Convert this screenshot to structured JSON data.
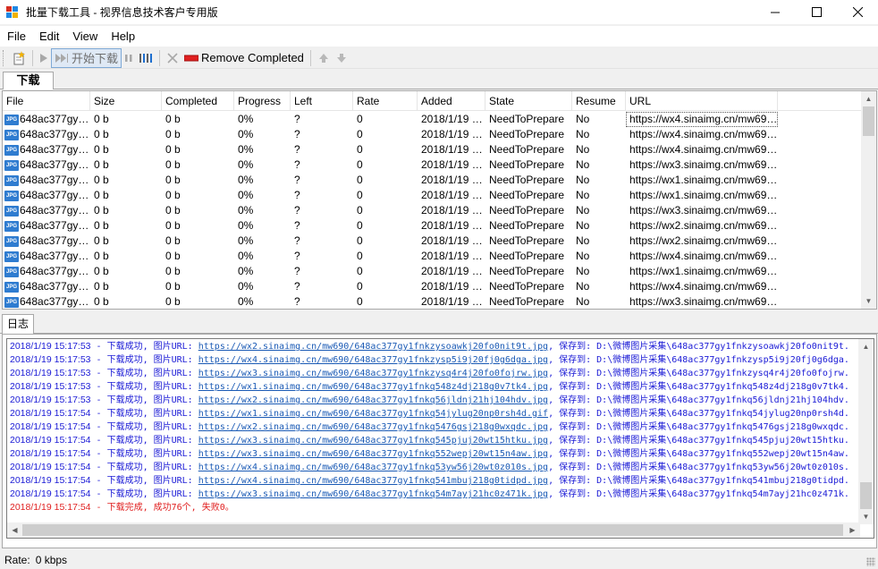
{
  "window": {
    "title": "批量下载工具 - 视界信息技术客户专用版",
    "minimize": "—",
    "maximize": "☐",
    "close": "✕"
  },
  "menu": [
    "File",
    "Edit",
    "View",
    "Help"
  ],
  "toolbar": {
    "start_label": "开始下载",
    "remove_completed_label": "Remove Completed"
  },
  "tabs": {
    "download": "下载",
    "log": "日志"
  },
  "grid": {
    "columns": [
      "File",
      "Size",
      "Completed",
      "Progress",
      "Left",
      "Rate",
      "Added",
      "State",
      "Resume",
      "URL"
    ],
    "rows": [
      [
        "648ac377gy…",
        "0 b",
        "0 b",
        "0%",
        "?",
        "0",
        "2018/1/19 …",
        "NeedToPrepare",
        "No",
        "https://wx4.sinaimg.cn/mw69…"
      ],
      [
        "648ac377gy…",
        "0 b",
        "0 b",
        "0%",
        "?",
        "0",
        "2018/1/19 …",
        "NeedToPrepare",
        "No",
        "https://wx4.sinaimg.cn/mw69…"
      ],
      [
        "648ac377gy…",
        "0 b",
        "0 b",
        "0%",
        "?",
        "0",
        "2018/1/19 …",
        "NeedToPrepare",
        "No",
        "https://wx4.sinaimg.cn/mw69…"
      ],
      [
        "648ac377gy…",
        "0 b",
        "0 b",
        "0%",
        "?",
        "0",
        "2018/1/19 …",
        "NeedToPrepare",
        "No",
        "https://wx3.sinaimg.cn/mw69…"
      ],
      [
        "648ac377gy…",
        "0 b",
        "0 b",
        "0%",
        "?",
        "0",
        "2018/1/19 …",
        "NeedToPrepare",
        "No",
        "https://wx1.sinaimg.cn/mw69…"
      ],
      [
        "648ac377gy…",
        "0 b",
        "0 b",
        "0%",
        "?",
        "0",
        "2018/1/19 …",
        "NeedToPrepare",
        "No",
        "https://wx1.sinaimg.cn/mw69…"
      ],
      [
        "648ac377gy…",
        "0 b",
        "0 b",
        "0%",
        "?",
        "0",
        "2018/1/19 …",
        "NeedToPrepare",
        "No",
        "https://wx3.sinaimg.cn/mw69…"
      ],
      [
        "648ac377gy…",
        "0 b",
        "0 b",
        "0%",
        "?",
        "0",
        "2018/1/19 …",
        "NeedToPrepare",
        "No",
        "https://wx2.sinaimg.cn/mw69…"
      ],
      [
        "648ac377gy…",
        "0 b",
        "0 b",
        "0%",
        "?",
        "0",
        "2018/1/19 …",
        "NeedToPrepare",
        "No",
        "https://wx2.sinaimg.cn/mw69…"
      ],
      [
        "648ac377gy…",
        "0 b",
        "0 b",
        "0%",
        "?",
        "0",
        "2018/1/19 …",
        "NeedToPrepare",
        "No",
        "https://wx4.sinaimg.cn/mw69…"
      ],
      [
        "648ac377gy…",
        "0 b",
        "0 b",
        "0%",
        "?",
        "0",
        "2018/1/19 …",
        "NeedToPrepare",
        "No",
        "https://wx1.sinaimg.cn/mw69…"
      ],
      [
        "648ac377gy…",
        "0 b",
        "0 b",
        "0%",
        "?",
        "0",
        "2018/1/19 …",
        "NeedToPrepare",
        "No",
        "https://wx4.sinaimg.cn/mw69…"
      ],
      [
        "648ac377gy…",
        "0 b",
        "0 b",
        "0%",
        "?",
        "0",
        "2018/1/19 …",
        "NeedToPrepare",
        "No",
        "https://wx3.sinaimg.cn/mw69…"
      ]
    ]
  },
  "log": {
    "lines": [
      {
        "time": "2018/1/19 15:17:53",
        "prefix": " - 下载成功, 图片URL: ",
        "url": "https://wx2.sinaimg.cn/mw690/648ac377gy1fnkzysoawkj20fo0nit9t.jpg",
        "suffix": ", 保存到: D:\\微博图片采集\\648ac377gy1fnkzysoawkj20fo0nit9t."
      },
      {
        "time": "2018/1/19 15:17:53",
        "prefix": " - 下载成功, 图片URL: ",
        "url": "https://wx4.sinaimg.cn/mw690/648ac377gy1fnkzysp5i9j20fj0g6dga.jpg",
        "suffix": ", 保存到: D:\\微博图片采集\\648ac377gy1fnkzysp5i9j20fj0g6dga."
      },
      {
        "time": "2018/1/19 15:17:53",
        "prefix": " - 下载成功, 图片URL: ",
        "url": "https://wx3.sinaimg.cn/mw690/648ac377gy1fnkzysq4r4j20fo0fojrw.jpg",
        "suffix": ", 保存到: D:\\微博图片采集\\648ac377gy1fnkzysq4r4j20fo0fojrw."
      },
      {
        "time": "2018/1/19 15:17:53",
        "prefix": " - 下载成功, 图片URL: ",
        "url": "https://wx1.sinaimg.cn/mw690/648ac377gy1fnkq548z4dj218g0v7tk4.jpg",
        "suffix": ", 保存到: D:\\微博图片采集\\648ac377gy1fnkq548z4dj218g0v7tk4."
      },
      {
        "time": "2018/1/19 15:17:53",
        "prefix": " - 下载成功, 图片URL: ",
        "url": "https://wx2.sinaimg.cn/mw690/648ac377gy1fnkq56jldnj21hj104hdv.jpg",
        "suffix": ", 保存到: D:\\微博图片采集\\648ac377gy1fnkq56jldnj21hj104hdv."
      },
      {
        "time": "2018/1/19 15:17:54",
        "prefix": " - 下载成功, 图片URL: ",
        "url": "https://wx1.sinaimg.cn/mw690/648ac377gy1fnkq54jylug20np0rsh4d.gif",
        "suffix": ", 保存到: D:\\微博图片采集\\648ac377gy1fnkq54jylug20np0rsh4d."
      },
      {
        "time": "2018/1/19 15:17:54",
        "prefix": " - 下载成功, 图片URL: ",
        "url": "https://wx2.sinaimg.cn/mw690/648ac377gy1fnkq5476gsj218g0wxqdc.jpg",
        "suffix": ", 保存到: D:\\微博图片采集\\648ac377gy1fnkq5476gsj218g0wxqdc."
      },
      {
        "time": "2018/1/19 15:17:54",
        "prefix": " - 下载成功, 图片URL: ",
        "url": "https://wx3.sinaimg.cn/mw690/648ac377gy1fnkq545pjuj20wt15htku.jpg",
        "suffix": ", 保存到: D:\\微博图片采集\\648ac377gy1fnkq545pjuj20wt15htku."
      },
      {
        "time": "2018/1/19 15:17:54",
        "prefix": " - 下载成功, 图片URL: ",
        "url": "https://wx3.sinaimg.cn/mw690/648ac377gy1fnkq552wepj20wt15n4aw.jpg",
        "suffix": ", 保存到: D:\\微博图片采集\\648ac377gy1fnkq552wepj20wt15n4aw."
      },
      {
        "time": "2018/1/19 15:17:54",
        "prefix": " - 下载成功, 图片URL: ",
        "url": "https://wx4.sinaimg.cn/mw690/648ac377gy1fnkq53yw56j20wt0z010s.jpg",
        "suffix": ", 保存到: D:\\微博图片采集\\648ac377gy1fnkq53yw56j20wt0z010s."
      },
      {
        "time": "2018/1/19 15:17:54",
        "prefix": " - 下载成功, 图片URL: ",
        "url": "https://wx4.sinaimg.cn/mw690/648ac377gy1fnkq541mbuj218g0tidpd.jpg",
        "suffix": ", 保存到: D:\\微博图片采集\\648ac377gy1fnkq541mbuj218g0tidpd."
      },
      {
        "time": "2018/1/19 15:17:54",
        "prefix": " - 下载成功, 图片URL: ",
        "url": "https://wx3.sinaimg.cn/mw690/648ac377gy1fnkq54m7ayj21hc0z471k.jpg",
        "suffix": ", 保存到: D:\\微博图片采集\\648ac377gy1fnkq54m7ayj21hc0z471k."
      }
    ],
    "summary": {
      "time": "2018/1/19 15:17:54",
      "text": " - 下载完成, 成功76个, 失败0。"
    }
  },
  "status": {
    "rate_label": "Rate:",
    "rate_value": "0 kbps"
  },
  "colors": {
    "log_blue": "#1a1ad6",
    "log_red": "#e02020",
    "link": "#1a5ab5"
  }
}
